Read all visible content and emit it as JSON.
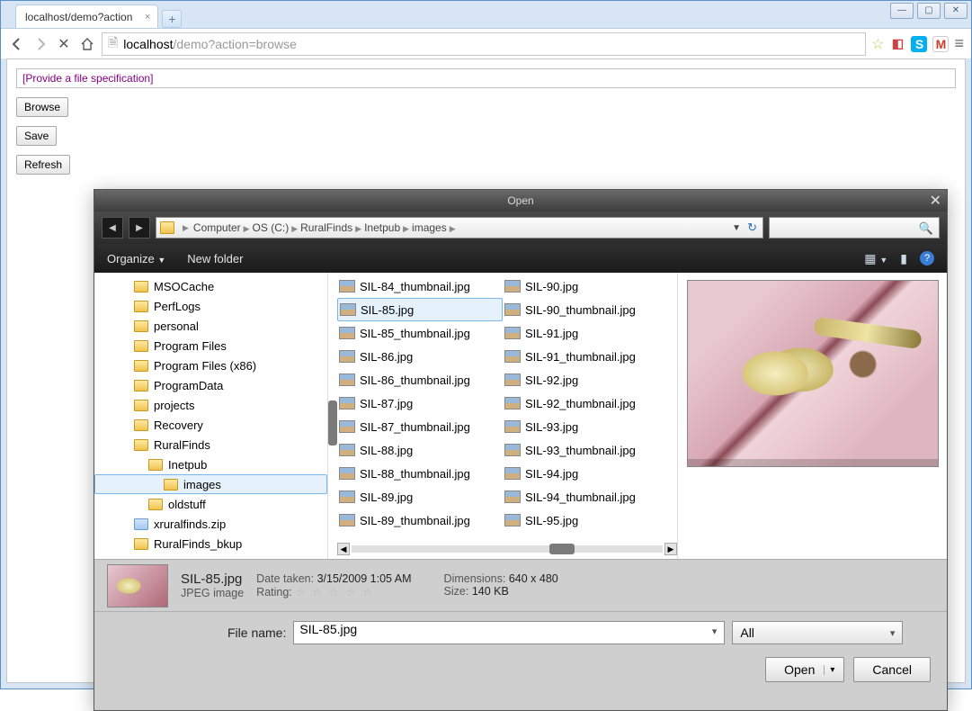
{
  "browser": {
    "tab_title": "localhost/demo?action",
    "url_host": "localhost",
    "url_path": "/demo?action=browse"
  },
  "page": {
    "spec_placeholder": "[Provide a file specification]",
    "browse_btn": "Browse",
    "save_btn": "Save",
    "refresh_btn": "Refresh"
  },
  "dlg": {
    "title": "Open",
    "breadcrumb": [
      "Computer",
      "OS (C:)",
      "RuralFinds",
      "Inetpub",
      "images"
    ],
    "organize": "Organize",
    "new_folder": "New folder",
    "tree": [
      {
        "name": "MSOCache",
        "level": 1,
        "type": "folder"
      },
      {
        "name": "PerfLogs",
        "level": 1,
        "type": "folder"
      },
      {
        "name": "personal",
        "level": 1,
        "type": "folder"
      },
      {
        "name": "Program Files",
        "level": 1,
        "type": "folder"
      },
      {
        "name": "Program Files (x86)",
        "level": 1,
        "type": "folder"
      },
      {
        "name": "ProgramData",
        "level": 1,
        "type": "folder"
      },
      {
        "name": "projects",
        "level": 1,
        "type": "folder"
      },
      {
        "name": "Recovery",
        "level": 1,
        "type": "folder"
      },
      {
        "name": "RuralFinds",
        "level": 1,
        "type": "folder"
      },
      {
        "name": "Inetpub",
        "level": 2,
        "type": "folder"
      },
      {
        "name": "images",
        "level": 3,
        "type": "folder",
        "sel": true
      },
      {
        "name": "oldstuff",
        "level": 2,
        "type": "folder"
      },
      {
        "name": "xruralfinds.zip",
        "level": 1,
        "type": "zip"
      },
      {
        "name": "RuralFinds_bkup",
        "level": 1,
        "type": "folder"
      }
    ],
    "files_col1": [
      "SIL-84_thumbnail.jpg",
      "SIL-85.jpg",
      "SIL-85_thumbnail.jpg",
      "SIL-86.jpg",
      "SIL-86_thumbnail.jpg",
      "SIL-87.jpg",
      "SIL-87_thumbnail.jpg",
      "SIL-88.jpg",
      "SIL-88_thumbnail.jpg",
      "SIL-89.jpg",
      "SIL-89_thumbnail.jpg"
    ],
    "files_col2": [
      "SIL-90.jpg",
      "SIL-90_thumbnail.jpg",
      "SIL-91.jpg",
      "SIL-91_thumbnail.jpg",
      "SIL-92.jpg",
      "SIL-92_thumbnail.jpg",
      "SIL-93.jpg",
      "SIL-93_thumbnail.jpg",
      "SIL-94.jpg",
      "SIL-94_thumbnail.jpg",
      "SIL-95.jpg"
    ],
    "selected_file": "SIL-85.jpg",
    "detail": {
      "name": "SIL-85.jpg",
      "type": "JPEG image",
      "date_label": "Date taken:",
      "date": "3/15/2009 1:05 AM",
      "rating_label": "Rating:",
      "dim_label": "Dimensions:",
      "dim": "640 x 480",
      "size_label": "Size:",
      "size": "140 KB"
    },
    "filename_label": "File name:",
    "filter": "All",
    "open_btn": "Open",
    "cancel_btn": "Cancel"
  }
}
